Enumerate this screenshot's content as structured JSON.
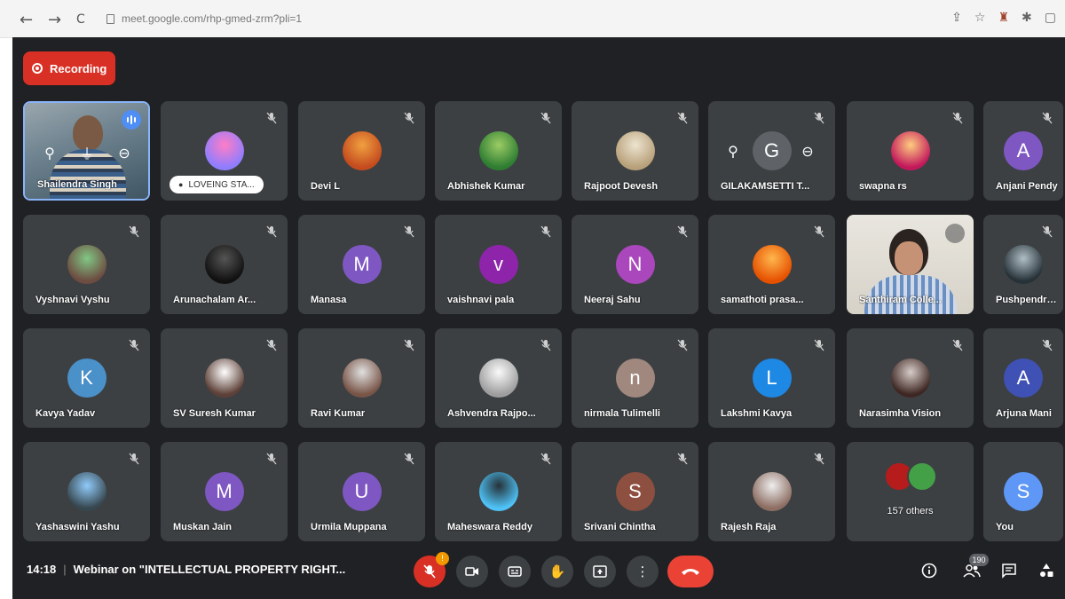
{
  "browser": {
    "back_icon": "←",
    "forward_icon": "→",
    "reload_icon": "C",
    "url": "meet.google.com/rhp-gmed-zrm?pli=1",
    "icons": [
      "share-icon",
      "star-icon",
      "extension-icon",
      "puzzle-icon",
      "sidebar-icon"
    ]
  },
  "recording_label": "Recording",
  "participants": [
    {
      "name": "Shailendra Singh",
      "type": "video",
      "speaking": true
    },
    {
      "name": "",
      "type": "photo",
      "status": "LOVEING STA...",
      "colors": [
        "#8e7dff",
        "#ff7dc6"
      ]
    },
    {
      "name": "Devi L",
      "type": "photo",
      "colors": [
        "#c44b1e",
        "#f0a040"
      ]
    },
    {
      "name": "Abhishek Kumar",
      "type": "photo",
      "colors": [
        "#2e7d32",
        "#9ccc65"
      ]
    },
    {
      "name": "Rajpoot Devesh",
      "type": "photo",
      "colors": [
        "#b8a07a",
        "#ede4d0"
      ]
    },
    {
      "name": "GILAKAMSETTI T...",
      "type": "initial",
      "initial": "G",
      "color": "#5f6368",
      "hover": true
    },
    {
      "name": "swapna rs",
      "type": "photo",
      "colors": [
        "#c2185b",
        "#ffcc80"
      ]
    },
    {
      "name": "Anjani Pendy",
      "type": "initial",
      "initial": "A",
      "color": "#7e57c2"
    },
    {
      "name": "Vyshnavi Vyshu",
      "type": "photo",
      "colors": [
        "#6d4c41",
        "#81c784"
      ]
    },
    {
      "name": "Arunachalam Ar...",
      "type": "photo",
      "colors": [
        "#111111",
        "#555555"
      ]
    },
    {
      "name": "Manasa",
      "type": "initial",
      "initial": "M",
      "color": "#7e57c2"
    },
    {
      "name": "vaishnavi pala",
      "type": "initial",
      "initial": "v",
      "color": "#8e24aa"
    },
    {
      "name": "Neeraj Sahu",
      "type": "initial",
      "initial": "N",
      "color": "#ab47bc"
    },
    {
      "name": "samathoti prasa...",
      "type": "photo",
      "colors": [
        "#e65100",
        "#ffb74d"
      ]
    },
    {
      "name": "Santhiram Colle...",
      "type": "video"
    },
    {
      "name": "Pushpendra K",
      "type": "photo",
      "colors": [
        "#263238",
        "#b0bec5"
      ]
    },
    {
      "name": "Kavya Yadav",
      "type": "initial",
      "initial": "K",
      "color": "#4a90c9"
    },
    {
      "name": "SV Suresh Kumar",
      "type": "photo",
      "colors": [
        "#5d4037",
        "#ffffff"
      ]
    },
    {
      "name": "Ravi Kumar",
      "type": "photo",
      "colors": [
        "#795548",
        "#e0e0e0"
      ]
    },
    {
      "name": "Ashvendra Rajpo...",
      "type": "photo",
      "colors": [
        "#9e9e9e",
        "#fafafa"
      ]
    },
    {
      "name": "nirmala Tulimelli",
      "type": "initial",
      "initial": "n",
      "color": "#a1887f"
    },
    {
      "name": "Lakshmi Kavya",
      "type": "initial",
      "initial": "L",
      "color": "#1e88e5"
    },
    {
      "name": "Narasimha Vision",
      "type": "photo",
      "colors": [
        "#3e2723",
        "#d7ccc8"
      ]
    },
    {
      "name": "Arjuna Mani",
      "type": "initial",
      "initial": "A",
      "color": "#3f51b5"
    },
    {
      "name": "Yashaswini Yashu",
      "type": "photo",
      "colors": [
        "#37474f",
        "#90caf9"
      ]
    },
    {
      "name": "Muskan Jain",
      "type": "initial",
      "initial": "M",
      "color": "#7e57c2"
    },
    {
      "name": "Urmila Muppana",
      "type": "initial",
      "initial": "U",
      "color": "#7e57c2"
    },
    {
      "name": "Maheswara Reddy",
      "type": "photo",
      "colors": [
        "#4fc3f7",
        "#263238"
      ]
    },
    {
      "name": "Srivani Chintha",
      "type": "initial",
      "initial": "S",
      "color": "#8d4f3f"
    },
    {
      "name": "Rajesh Raja",
      "type": "photo",
      "colors": [
        "#8d6e63",
        "#eeeeee"
      ]
    },
    {
      "name": "157 others",
      "type": "others"
    },
    {
      "name": "You",
      "type": "initial",
      "initial": "S",
      "color": "#5e97f6"
    }
  ],
  "bottom": {
    "time": "14:18",
    "meeting_title": "Webinar on \"INTELLECTUAL PROPERTY RIGHT...",
    "mic_badge": "!",
    "participant_count": "190"
  }
}
